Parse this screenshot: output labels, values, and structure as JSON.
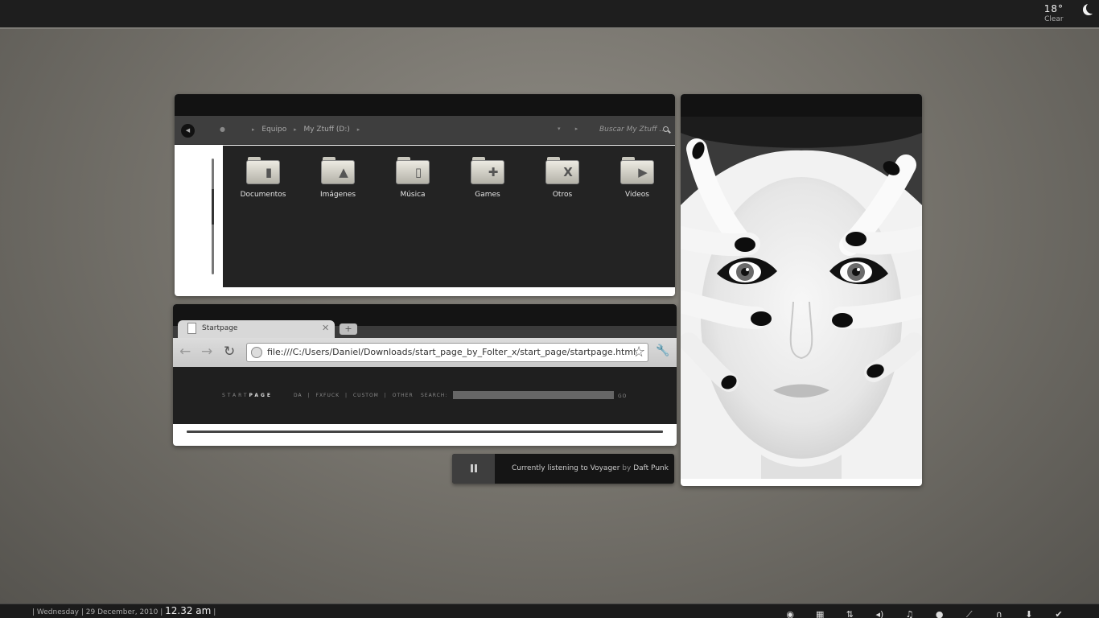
{
  "weather": {
    "temp": "18°",
    "condition": "Clear"
  },
  "explorer": {
    "breadcrumbs": [
      "Equipo",
      "My Ztuff (D:)"
    ],
    "search_placeholder": "Buscar My Ztuff ...",
    "folders": [
      {
        "label": "Documentos",
        "icon": "document-icon",
        "glyph": "▮"
      },
      {
        "label": "Imágenes",
        "icon": "image-icon",
        "glyph": "▲"
      },
      {
        "label": "Música",
        "icon": "music-player-icon",
        "glyph": "▯"
      },
      {
        "label": "Games",
        "icon": "gamepad-icon",
        "glyph": "✚"
      },
      {
        "label": "Otros",
        "icon": "x-icon",
        "glyph": "X"
      },
      {
        "label": "Videos",
        "icon": "play-icon",
        "glyph": "▶"
      }
    ]
  },
  "browser": {
    "tab_title": "Startpage",
    "url": "file:///C:/Users/Daniel/Downloads/start_page_by_Folter_x/start_page/startpage.html",
    "startpage": {
      "logo_light": "START",
      "logo_bold": "PAGE",
      "links": [
        "DA",
        "|",
        "FXFUCK",
        "|",
        "CUSTOM",
        "|",
        "OTHER"
      ],
      "search_label": "SEARCH:",
      "go_label": "GO"
    }
  },
  "player": {
    "prefix": "Currently listening to",
    "track": "Voyager",
    "by": "by",
    "artist": "Daft Punk"
  },
  "taskbar": {
    "date": "| Wednesday | 29 December, 2010 |",
    "time": "12.32 am",
    "trailing_sep": "|",
    "tray_icons": [
      "chrome-icon",
      "grid-icon",
      "sliders-icon",
      "volume-icon",
      "music-note-icon",
      "chat-icon",
      "ruler-icon",
      "headphones-icon",
      "download-icon",
      "checkmark-icon"
    ],
    "tray_glyphs": [
      "◉",
      "▦",
      "⇅",
      "◂)",
      "♫",
      "●",
      "⟋",
      "∩",
      "⬇",
      "✔"
    ]
  },
  "colors": {
    "wallpaper": "#77746d",
    "window_dark": "#121212",
    "explorer_content": "#232323",
    "startpage_bg": "#1f1f1f"
  }
}
